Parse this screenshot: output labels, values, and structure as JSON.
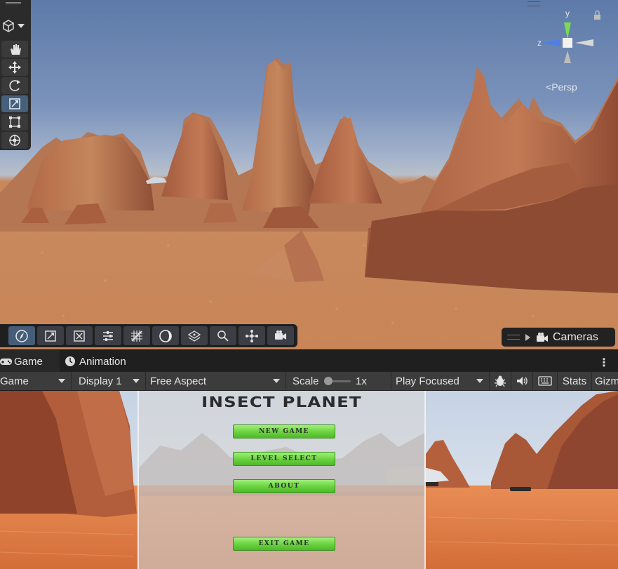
{
  "scene_view": {
    "gizmo": {
      "y_label": "y",
      "z_label": "z"
    },
    "persp_label": "Persp",
    "cameras_label": "Cameras",
    "tool_icons": [
      "view-tool-icon",
      "move-tool-icon",
      "rotate-tool-icon",
      "scale-tool-icon",
      "rect-tool-icon",
      "transform-tool-icon"
    ],
    "overlay_icons": [
      "compass-icon",
      "scale-icon",
      "snap-icon",
      "align-icon",
      "grid-icon",
      "shading-icon",
      "layers-icon",
      "search-icon",
      "pivot-icon",
      "camera-icon"
    ]
  },
  "tabs": [
    {
      "label": "Game",
      "icon": "gamepad-icon"
    },
    {
      "label": "Animation",
      "icon": "clock-icon"
    }
  ],
  "game_toolbar": {
    "mode": "Game",
    "display": "Display 1",
    "aspect": "Free Aspect",
    "scale_label": "Scale",
    "scale_value": "1x",
    "scale_level": 0.05,
    "play_mode": "Play Focused",
    "stats_label": "Stats",
    "gizmos_label": "Gizm"
  },
  "game_menu": {
    "title": "INSECT PLANET",
    "buttons": [
      "NEW GAME",
      "LEVEL SELECT",
      "ABOUT",
      "EXIT GAME"
    ]
  },
  "colors": {
    "button_green": "#69d23e",
    "sand": "#d8743f",
    "toolbar": "#3c3c3c"
  }
}
